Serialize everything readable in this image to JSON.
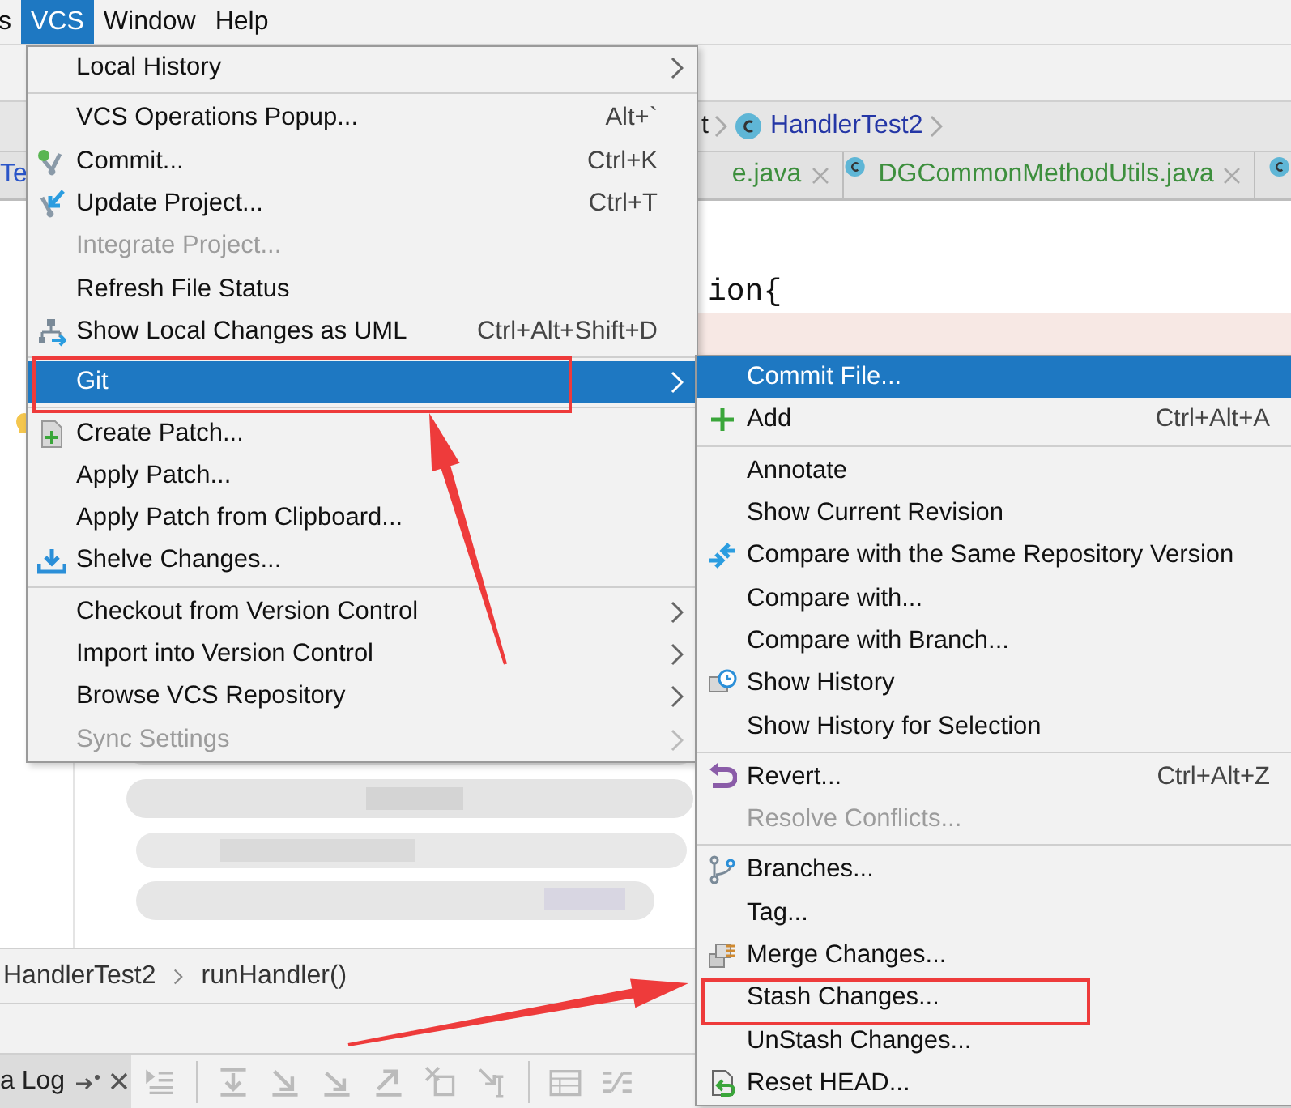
{
  "menu_bar": {
    "items": [
      {
        "label": "s",
        "selected": false
      },
      {
        "label": "VCS",
        "selected": true
      },
      {
        "label": "Window",
        "selected": false
      },
      {
        "label": "Help",
        "selected": false
      }
    ]
  },
  "navigation_bar": {
    "crumbs": [
      "t",
      "HandlerTest2"
    ]
  },
  "editor_tabs": [
    {
      "label": "Te",
      "color": "#2a55c8",
      "closable": false
    },
    {
      "label": "e.java",
      "color": "#3d8f3d",
      "closable": true
    },
    {
      "label": "DGCommonMethodUtils.java",
      "color": "#3d8f3d",
      "closable": true
    }
  ],
  "editor": {
    "code_fragment": "ion{"
  },
  "breadcrumbs": [
    "HandlerTest2",
    "runHandler()"
  ],
  "tool_window": {
    "tab": "a Log"
  },
  "vcs_menu": {
    "sections": [
      {
        "items": [
          {
            "label": "Local History",
            "kind": "plain",
            "selected": false,
            "disabled": false,
            "has_submenu": true,
            "outlined": false
          }
        ]
      },
      {
        "items": [
          {
            "label": "VCS Operations Popup...",
            "shortcut": "Alt+`",
            "kind": "plain",
            "selected": false,
            "disabled": false,
            "has_submenu": false,
            "outlined": false
          },
          {
            "label": "Commit...",
            "shortcut": "Ctrl+K",
            "kind": "commit",
            "selected": false,
            "disabled": false,
            "has_submenu": false,
            "outlined": false
          },
          {
            "label": "Update Project...",
            "shortcut": "Ctrl+T",
            "kind": "update",
            "selected": false,
            "disabled": false,
            "has_submenu": false,
            "outlined": false
          },
          {
            "label": "Integrate Project...",
            "kind": "plain",
            "selected": false,
            "disabled": true,
            "has_submenu": false,
            "outlined": false
          },
          {
            "label": "Refresh File Status",
            "kind": "plain",
            "selected": false,
            "disabled": false,
            "has_submenu": false,
            "outlined": false
          },
          {
            "label": "Show Local Changes as UML",
            "shortcut": "Ctrl+Alt+Shift+D",
            "kind": "uml",
            "selected": false,
            "disabled": false,
            "has_submenu": false,
            "outlined": false
          }
        ]
      },
      {
        "items": [
          {
            "label": "Git",
            "kind": "plain",
            "selected": true,
            "disabled": false,
            "has_submenu": true,
            "outlined": true
          }
        ]
      },
      {
        "items": [
          {
            "label": "Create Patch...",
            "kind": "patch",
            "selected": false,
            "disabled": false,
            "has_submenu": false,
            "outlined": false
          },
          {
            "label": "Apply Patch...",
            "kind": "plain",
            "selected": false,
            "disabled": false,
            "has_submenu": false,
            "outlined": false
          },
          {
            "label": "Apply Patch from Clipboard...",
            "kind": "plain",
            "selected": false,
            "disabled": false,
            "has_submenu": false,
            "outlined": false
          },
          {
            "label": "Shelve Changes...",
            "kind": "shelve",
            "selected": false,
            "disabled": false,
            "has_submenu": false,
            "outlined": false
          }
        ]
      },
      {
        "items": [
          {
            "label": "Checkout from Version Control",
            "kind": "plain",
            "selected": false,
            "disabled": false,
            "has_submenu": true,
            "outlined": false
          },
          {
            "label": "Import into Version Control",
            "kind": "plain",
            "selected": false,
            "disabled": false,
            "has_submenu": true,
            "outlined": false
          },
          {
            "label": "Browse VCS Repository",
            "kind": "plain",
            "selected": false,
            "disabled": false,
            "has_submenu": true,
            "outlined": false
          },
          {
            "label": "Sync Settings",
            "kind": "plain",
            "selected": false,
            "disabled": true,
            "has_submenu": true,
            "outlined": false
          }
        ]
      }
    ]
  },
  "git_submenu": {
    "sections": [
      {
        "items": [
          {
            "label": "Commit File...",
            "kind": "plain",
            "selected": true,
            "disabled": false,
            "outlined": false
          },
          {
            "label": "Add",
            "shortcut": "Ctrl+Alt+A",
            "kind": "add",
            "selected": false,
            "disabled": false,
            "outlined": false
          }
        ]
      },
      {
        "items": [
          {
            "label": "Annotate",
            "kind": "plain",
            "selected": false,
            "disabled": false,
            "outlined": false
          },
          {
            "label": "Show Current Revision",
            "kind": "plain",
            "selected": false,
            "disabled": false,
            "outlined": false
          },
          {
            "label": "Compare with the Same Repository Version",
            "kind": "compare",
            "selected": false,
            "disabled": false,
            "outlined": false
          },
          {
            "label": "Compare with...",
            "kind": "plain",
            "selected": false,
            "disabled": false,
            "outlined": false
          },
          {
            "label": "Compare with Branch...",
            "kind": "plain",
            "selected": false,
            "disabled": false,
            "outlined": false
          },
          {
            "label": "Show History",
            "kind": "history",
            "selected": false,
            "disabled": false,
            "outlined": false
          },
          {
            "label": "Show History for Selection",
            "kind": "plain",
            "selected": false,
            "disabled": false,
            "outlined": false
          }
        ]
      },
      {
        "items": [
          {
            "label": "Revert...",
            "shortcut": "Ctrl+Alt+Z",
            "kind": "revert",
            "selected": false,
            "disabled": false,
            "outlined": false
          },
          {
            "label": "Resolve Conflicts...",
            "kind": "plain",
            "selected": false,
            "disabled": true,
            "outlined": false
          }
        ]
      },
      {
        "items": [
          {
            "label": "Branches...",
            "kind": "branches",
            "selected": false,
            "disabled": false,
            "outlined": false
          },
          {
            "label": "Tag...",
            "kind": "plain",
            "selected": false,
            "disabled": false,
            "outlined": false
          },
          {
            "label": "Merge Changes...",
            "kind": "merge",
            "selected": false,
            "disabled": false,
            "outlined": false
          },
          {
            "label": "Stash Changes...",
            "kind": "plain",
            "selected": false,
            "disabled": false,
            "outlined": true
          },
          {
            "label": "UnStash Changes...",
            "kind": "plain",
            "selected": false,
            "disabled": false,
            "outlined": false
          },
          {
            "label": "Reset HEAD...",
            "kind": "reset",
            "selected": false,
            "disabled": false,
            "outlined": false
          }
        ]
      }
    ]
  }
}
